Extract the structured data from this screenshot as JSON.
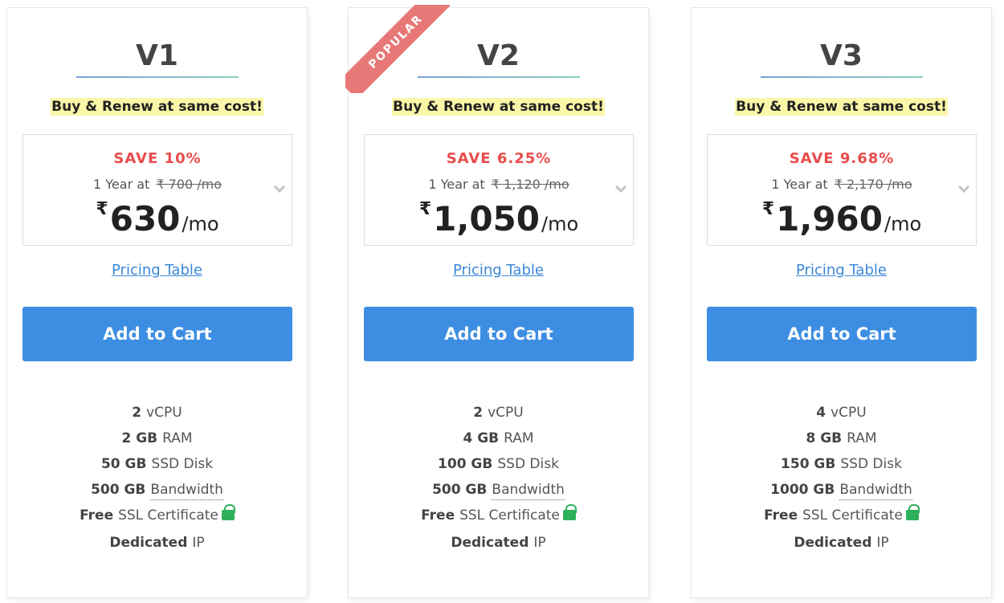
{
  "plans": [
    {
      "name": "V1",
      "badge": "",
      "renew_note": "Buy & Renew at same cost!",
      "save_text": "SAVE 10%",
      "term_label": "1 Year at",
      "old_price": "₹ 700 /mo",
      "currency": "₹",
      "price": "630",
      "per": "/mo",
      "pricing_link": "Pricing Table",
      "cta": "Add to Cart",
      "features": [
        {
          "value": "2",
          "label": "vCPU"
        },
        {
          "value": "2 GB",
          "label": "RAM"
        },
        {
          "value": "50 GB",
          "label": "SSD Disk"
        },
        {
          "value": "500 GB",
          "label": "Bandwidth"
        },
        {
          "value": "Free",
          "label": "SSL Certificate"
        },
        {
          "value": "Dedicated",
          "label": "IP"
        }
      ]
    },
    {
      "name": "V2",
      "badge": "POPULAR",
      "renew_note": "Buy & Renew at same cost!",
      "save_text": "SAVE 6.25%",
      "term_label": "1 Year at",
      "old_price": "₹ 1,120 /mo",
      "currency": "₹",
      "price": "1,050",
      "per": "/mo",
      "pricing_link": "Pricing Table",
      "cta": "Add to Cart",
      "features": [
        {
          "value": "2",
          "label": "vCPU"
        },
        {
          "value": "4 GB",
          "label": "RAM"
        },
        {
          "value": "100 GB",
          "label": "SSD Disk"
        },
        {
          "value": "500 GB",
          "label": "Bandwidth"
        },
        {
          "value": "Free",
          "label": "SSL Certificate"
        },
        {
          "value": "Dedicated",
          "label": "IP"
        }
      ]
    },
    {
      "name": "V3",
      "badge": "",
      "renew_note": "Buy & Renew at same cost!",
      "save_text": "SAVE 9.68%",
      "term_label": "1 Year at",
      "old_price": "₹ 2,170 /mo",
      "currency": "₹",
      "price": "1,960",
      "per": "/mo",
      "pricing_link": "Pricing Table",
      "cta": "Add to Cart",
      "features": [
        {
          "value": "4",
          "label": "vCPU"
        },
        {
          "value": "8 GB",
          "label": "RAM"
        },
        {
          "value": "150 GB",
          "label": "SSD Disk"
        },
        {
          "value": "1000 GB",
          "label": "Bandwidth"
        },
        {
          "value": "Free",
          "label": "SSL Certificate"
        },
        {
          "value": "Dedicated",
          "label": "IP"
        }
      ]
    }
  ],
  "icons": {
    "term_dropdown": "chevron-down-icon",
    "ssl": "lock-icon"
  },
  "colors": {
    "accent": "#3d8ee2",
    "save": "#e84c4c",
    "badge": "#e87878",
    "highlight": "#fbf7a8",
    "lock": "#2eb05a"
  }
}
